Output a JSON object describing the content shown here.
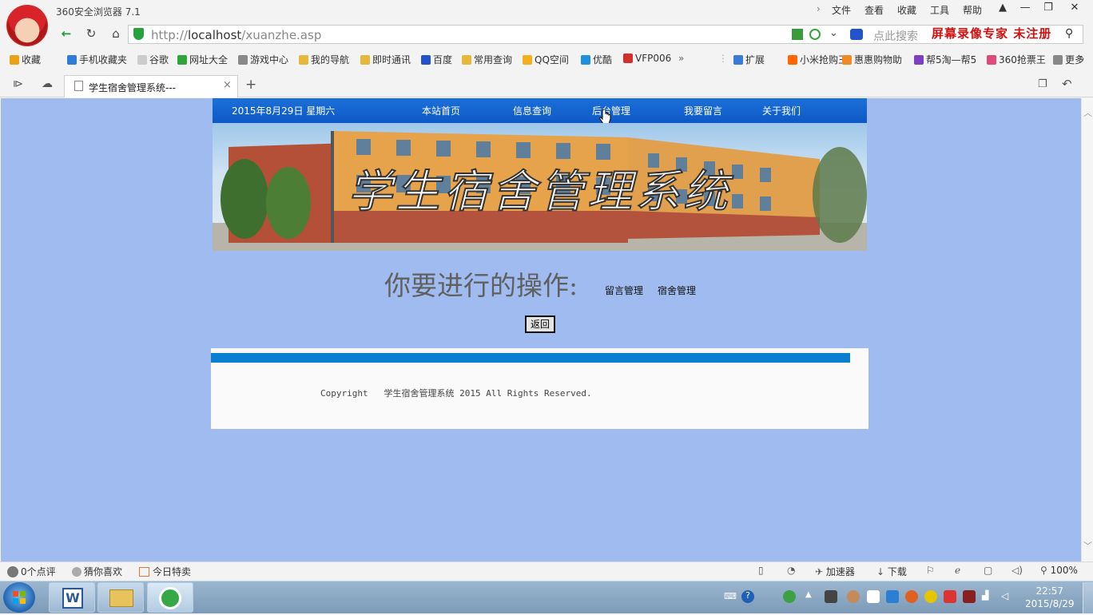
{
  "browser": {
    "app_name": "360安全浏览器 7.1",
    "menu": [
      "文件",
      "查看",
      "收藏",
      "工具",
      "帮助"
    ],
    "url_prefix": "http://",
    "url_host": "localhost",
    "url_path": "/xuanzhe.asp",
    "search_placeholder": "点此搜索",
    "recorder_watermark": "屏幕录像专家  未注册",
    "bookmarks": [
      {
        "label": "收藏",
        "color": "#e8a317"
      },
      {
        "label": "手机收藏夹",
        "color": "#2f7bd8"
      },
      {
        "label": "谷歌",
        "color": "#cccccc"
      },
      {
        "label": "网址大全",
        "color": "#2ea43a"
      },
      {
        "label": "游戏中心",
        "color": "#888888"
      },
      {
        "label": "我的导航",
        "color": "#e5b73b"
      },
      {
        "label": "即时通讯",
        "color": "#e5b73b"
      },
      {
        "label": "百度",
        "color": "#2452c9"
      },
      {
        "label": "常用查询",
        "color": "#e5b73b"
      },
      {
        "label": "QQ空间",
        "color": "#f2b01e"
      },
      {
        "label": "优酷",
        "color": "#1e90e0"
      },
      {
        "label": "VFP006",
        "color": "#d32f2f"
      }
    ],
    "bookmarks_right": [
      {
        "label": "扩展",
        "color": "#3a7bd5"
      },
      {
        "label": "小米抢购王",
        "color": "#ff6600"
      },
      {
        "label": "惠惠购物助",
        "color": "#f08a24"
      },
      {
        "label": "帮5淘—帮5",
        "color": "#7b3fbf"
      },
      {
        "label": "360抢票王",
        "color": "#e04a7a"
      },
      {
        "label": "更多",
        "color": "#888888"
      }
    ],
    "tab_title": "学生宿舍管理系统---",
    "status_left": [
      "0个点评",
      "猜你喜欢",
      "今日特卖"
    ],
    "status_right": [
      "加速器",
      "下载",
      "100%"
    ]
  },
  "page": {
    "date": "2015年8月29日  星期六",
    "nav": [
      "本站首页",
      "信息查询",
      "后台管理",
      "我要留言",
      "关于我们"
    ],
    "banner_title": "学生宿舍管理系统",
    "prompt": "你要进行的操作:",
    "links": [
      "留言管理",
      "宿舍管理"
    ],
    "back_button": "返回",
    "copyright": "Copyright   学生宿舍管理系统 2015 All Rights Reserved."
  },
  "taskbar": {
    "time": "22:57",
    "date": "2015/8/29"
  },
  "colors": {
    "page_bg": "#a0bbef",
    "nav_bg": "#1565d1",
    "footer_stripe": "#0a7fcf",
    "watermark": "#d21010"
  }
}
